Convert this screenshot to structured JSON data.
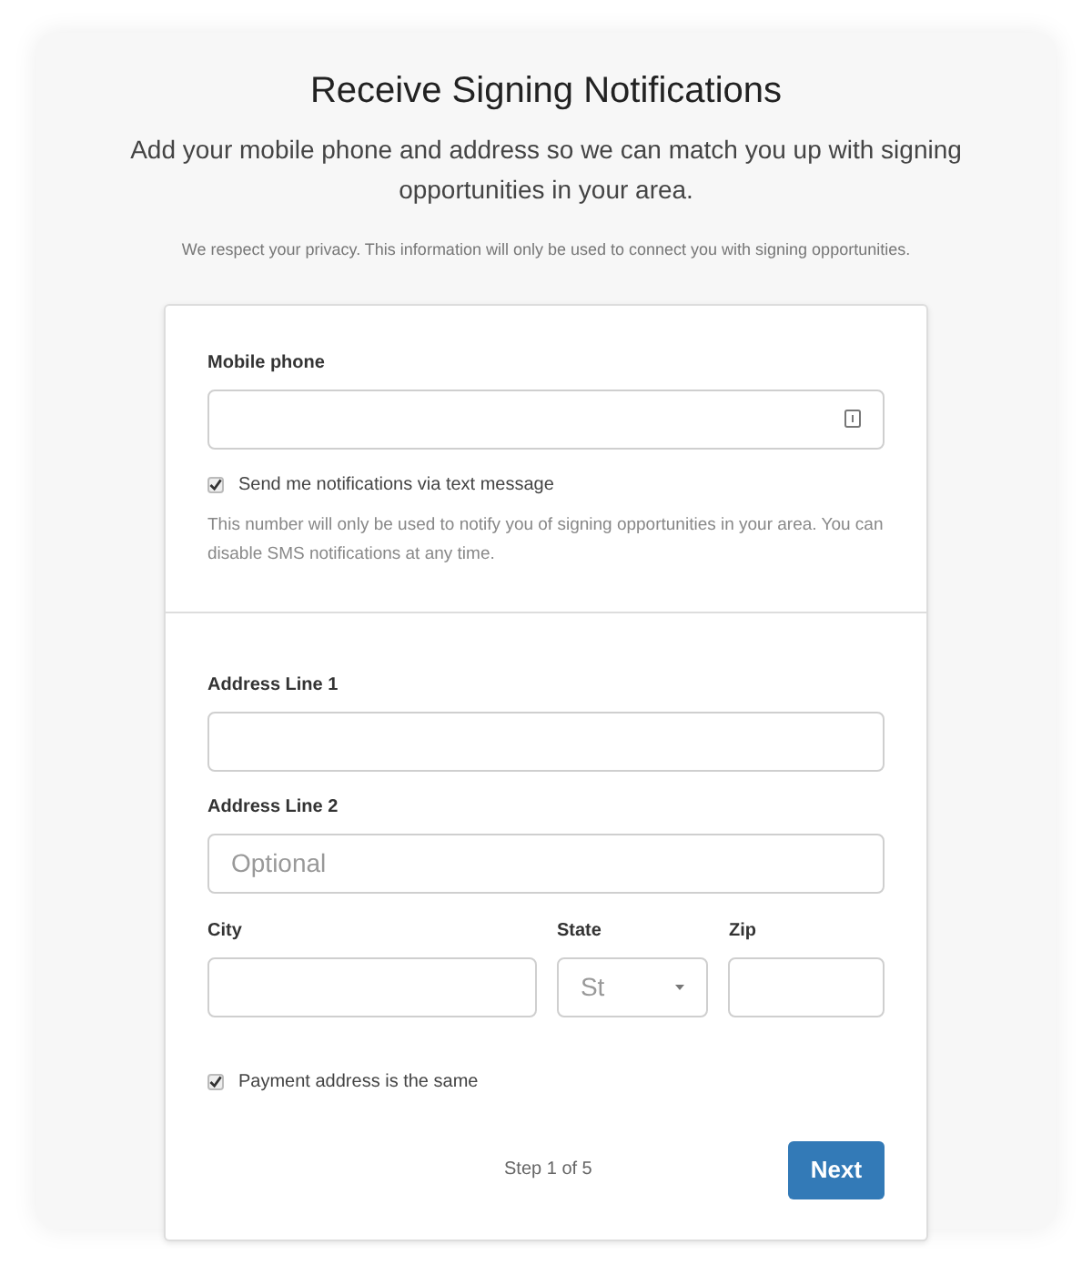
{
  "title": "Receive Signing Notifications",
  "subtitle": "Add your mobile phone and address so we can match you up with signing opportunities in your area.",
  "privacy_note": "We respect your privacy. This information will only be used to connect you with signing opportunities.",
  "phone": {
    "label": "Mobile phone",
    "sms_checkbox": {
      "label": "Send me notifications via text message",
      "checked": true
    },
    "help": "This number will only be used to notify you of signing opportunities in your area. You can disable SMS notifications at any time."
  },
  "address_line_1": {
    "label": "Address Line 1"
  },
  "address_line_2": {
    "label": "Address Line 2",
    "placeholder": "Optional"
  },
  "city": {
    "label": "City"
  },
  "state": {
    "label": "State",
    "placeholder": "St"
  },
  "zip": {
    "label": "Zip"
  },
  "payment_checkbox": {
    "label": "Payment address is the same",
    "checked": true
  },
  "step": "Step 1 of 5",
  "next_button": "Next"
}
